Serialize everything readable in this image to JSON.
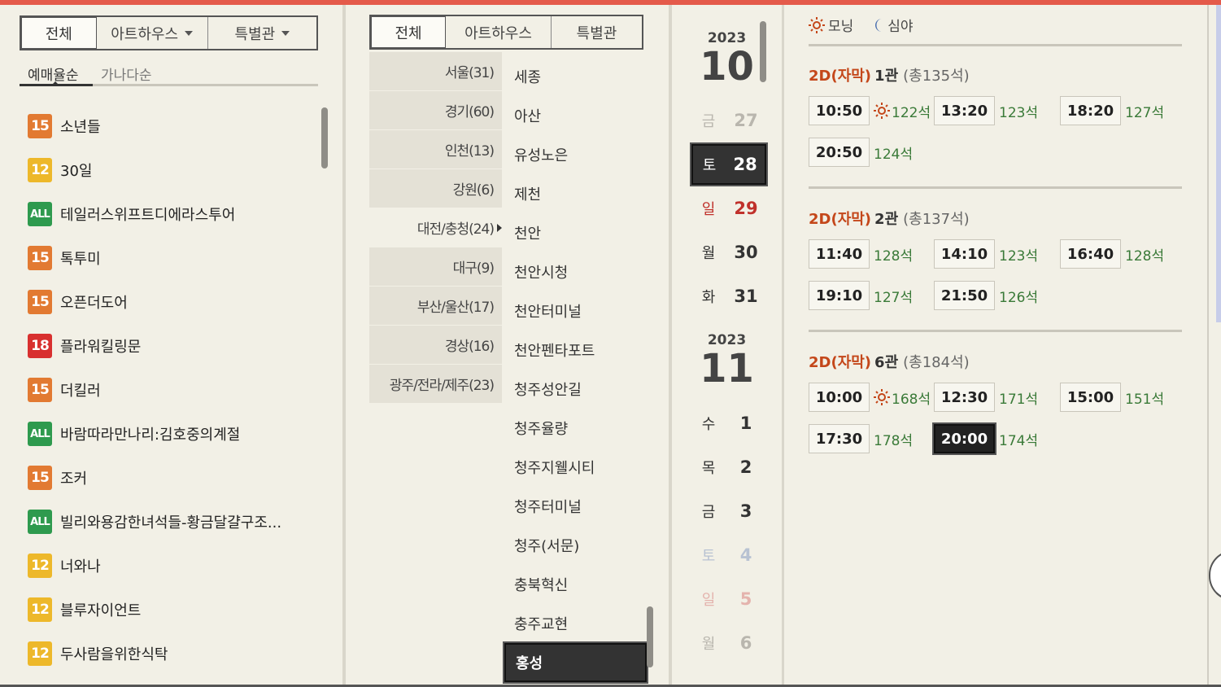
{
  "movie_tabs": [
    "전체",
    "아트하우스",
    "특별관"
  ],
  "sort_tabs": [
    "예매율순",
    "가나다순"
  ],
  "movies": [
    {
      "rating": "15",
      "title": "소년들"
    },
    {
      "rating": "12",
      "title": "30일"
    },
    {
      "rating": "ALL",
      "title": "테일러스위프트디에라스투어"
    },
    {
      "rating": "15",
      "title": "톡투미"
    },
    {
      "rating": "15",
      "title": "오픈더도어"
    },
    {
      "rating": "18",
      "title": "플라워킬링문"
    },
    {
      "rating": "15",
      "title": "더킬러"
    },
    {
      "rating": "ALL",
      "title": "바람따라만나리:김호중의계절"
    },
    {
      "rating": "15",
      "title": "조커"
    },
    {
      "rating": "ALL",
      "title": "빌리와용감한녀석들-황금달걀구조..."
    },
    {
      "rating": "12",
      "title": "너와나"
    },
    {
      "rating": "12",
      "title": "블루자이언트"
    },
    {
      "rating": "12",
      "title": "두사람을위한식탁"
    }
  ],
  "theater_tabs": [
    "전체",
    "아트하우스",
    "특별관"
  ],
  "regions": [
    "서울(31)",
    "경기(60)",
    "인천(13)",
    "강원(6)",
    "대전/충청(24)",
    "대구(9)",
    "부산/울산(17)",
    "경상(16)",
    "광주/전라/제주(23)"
  ],
  "theaters": [
    "세종",
    "아산",
    "유성노은",
    "제천",
    "천안",
    "천안시청",
    "천안터미널",
    "천안펜타포트",
    "청주성안길",
    "청주율량",
    "청주지웰시티",
    "청주터미널",
    "청주(서문)",
    "충북혁신",
    "충주교현",
    "홍성"
  ],
  "dates": {
    "month1": {
      "year": "2023",
      "month": "10"
    },
    "month2": {
      "year": "2023",
      "month": "11"
    },
    "days": [
      {
        "dow": "금",
        "num": "27"
      },
      {
        "dow": "토",
        "num": "28"
      },
      {
        "dow": "일",
        "num": "29"
      },
      {
        "dow": "월",
        "num": "30"
      },
      {
        "dow": "화",
        "num": "31"
      },
      {
        "dow": "수",
        "num": "1"
      },
      {
        "dow": "목",
        "num": "2"
      },
      {
        "dow": "금",
        "num": "3"
      },
      {
        "dow": "토",
        "num": "4"
      },
      {
        "dow": "일",
        "num": "5"
      },
      {
        "dow": "월",
        "num": "6"
      }
    ]
  },
  "legend": {
    "morning": "모닝",
    "night": "심야"
  },
  "halls": [
    {
      "format": "2D(자막)",
      "name": "1관",
      "total": "(총135석)",
      "times": [
        {
          "time": "10:50",
          "remain": "122석",
          "morning": true
        },
        {
          "time": "13:20",
          "remain": "123석"
        },
        {
          "time": "18:20",
          "remain": "127석"
        },
        {
          "time": "20:50",
          "remain": "124석"
        }
      ]
    },
    {
      "format": "2D(자막)",
      "name": "2관",
      "total": "(총137석)",
      "times": [
        {
          "time": "11:40",
          "remain": "128석"
        },
        {
          "time": "14:10",
          "remain": "123석"
        },
        {
          "time": "16:40",
          "remain": "128석"
        },
        {
          "time": "19:10",
          "remain": "127석"
        },
        {
          "time": "21:50",
          "remain": "126석"
        }
      ]
    },
    {
      "format": "2D(자막)",
      "name": "6관",
      "total": "(총184석)",
      "times": [
        {
          "time": "10:00",
          "remain": "168석",
          "morning": true
        },
        {
          "time": "12:30",
          "remain": "171석"
        },
        {
          "time": "15:00",
          "remain": "151석"
        },
        {
          "time": "17:30",
          "remain": "178석"
        },
        {
          "time": "20:00",
          "remain": "174석",
          "selected": true
        }
      ]
    }
  ],
  "colors": {
    "accent": "#e45a4a",
    "sunday": "#c0312b",
    "remaining": "#3a7a38",
    "format": "#c4471a"
  }
}
